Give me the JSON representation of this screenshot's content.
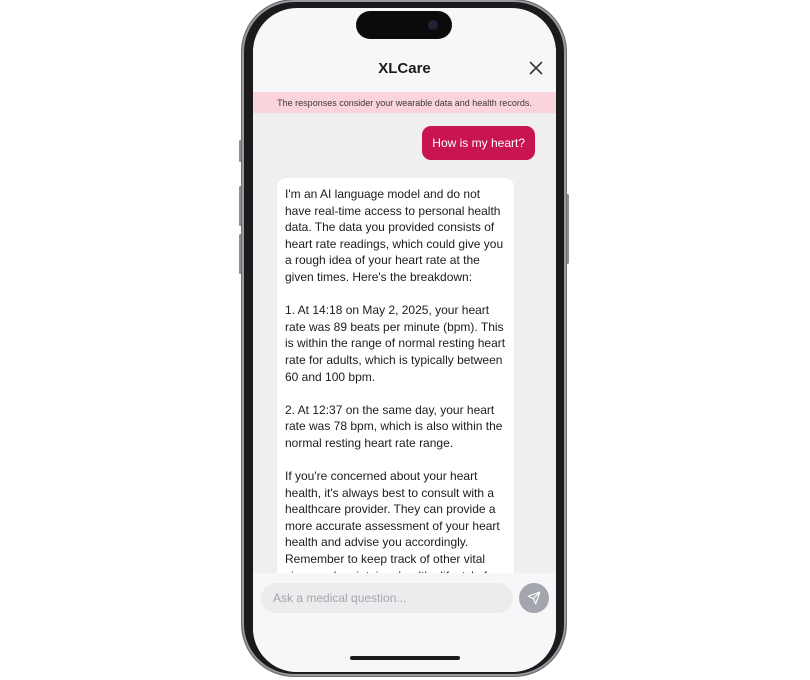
{
  "app": {
    "title": "XLCare",
    "banner": "The responses consider your wearable data and health records."
  },
  "chat": {
    "user_message": "How is my heart?",
    "assistant_paragraphs": [
      "I'm an AI language model and do not have real-time access to personal health data. The data you provided consists of heart rate readings, which could give you a rough idea of your heart rate at the given times. Here's the breakdown:",
      "1. At 14:18 on May 2, 2025, your heart rate was 89 beats per minute (bpm). This is within the range of normal resting heart rate for adults, which is typically between 60 and 100 bpm.",
      "2. At 12:37 on the same day, your heart rate was 78 bpm, which is also within the normal resting heart rate range.",
      "If you're concerned about your heart health, it's always best to consult with a healthcare provider. They can provide a more accurate assessment of your heart health and advise you accordingly. Remember to keep track of other vital signs and maintain a healthy lifestyle for the best heart health."
    ]
  },
  "composer": {
    "placeholder": "Ask a medical question...",
    "value": ""
  },
  "icons": {
    "close": "close-icon",
    "send": "send-icon"
  },
  "colors": {
    "accent": "#c8144f",
    "banner_bg": "#fbd3dc",
    "send_button": "#a3a6ac"
  }
}
